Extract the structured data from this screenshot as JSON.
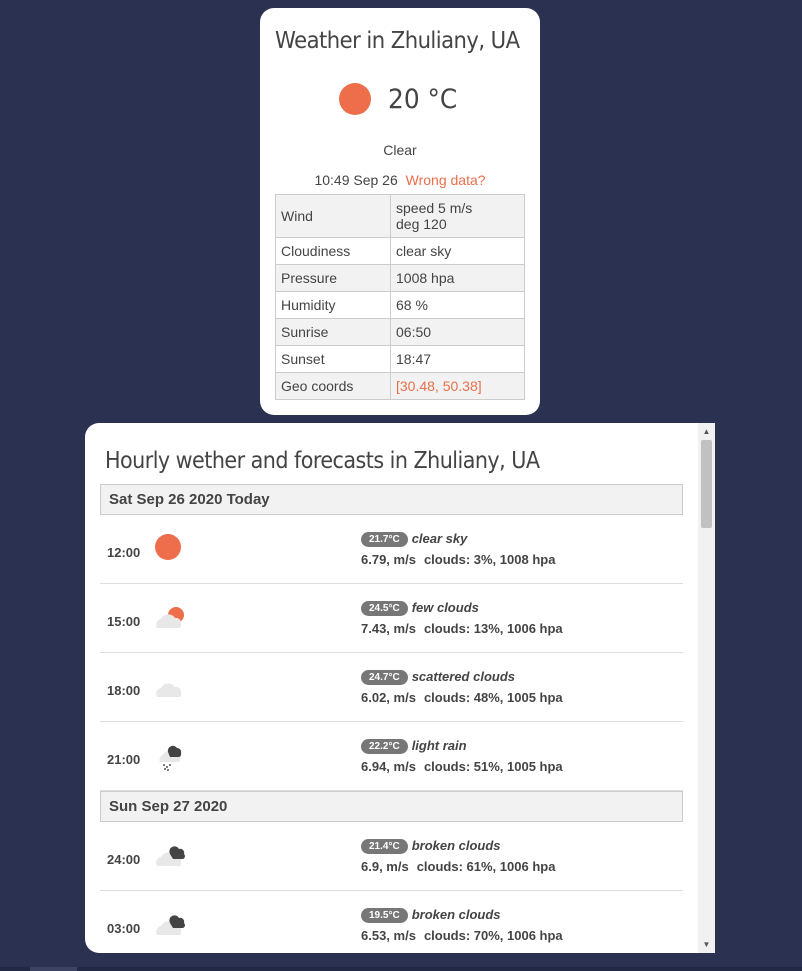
{
  "current": {
    "title": "Weather in Zhuliany, UA",
    "temperature": "20 °C",
    "icon": "sun-icon",
    "description": "Clear",
    "time": "10:49 Sep 26",
    "wrong_data_link": "Wrong data?",
    "details": [
      {
        "label": "Wind",
        "value": "speed 5 m/s",
        "value2": "deg 120"
      },
      {
        "label": "Cloudiness",
        "value": "clear sky"
      },
      {
        "label": "Pressure",
        "value": "1008 hpa"
      },
      {
        "label": "Humidity",
        "value": "68 %"
      },
      {
        "label": "Sunrise",
        "value": "06:50"
      },
      {
        "label": "Sunset",
        "value": "18:47"
      },
      {
        "label": "Geo coords",
        "value": "[30.48, 50.38]"
      }
    ]
  },
  "hourly": {
    "title": "Hourly wether and forecasts in Zhuliany, UA",
    "days": [
      {
        "label": "Sat Sep 26 2020 Today",
        "rows": [
          {
            "time": "12:00",
            "icon": "sun-icon",
            "temp": "21.7°C",
            "condition": "clear sky",
            "wind": "6.79, m/s",
            "clouds": "clouds: 3%, 1008 hpa"
          },
          {
            "time": "15:00",
            "icon": "few-clouds-icon",
            "temp": "24.5°C",
            "condition": "few clouds",
            "wind": "7.43, m/s",
            "clouds": "clouds: 13%, 1006 hpa"
          },
          {
            "time": "18:00",
            "icon": "cloud-icon",
            "temp": "24.7°C",
            "condition": "scattered clouds",
            "wind": "6.02, m/s",
            "clouds": "clouds: 48%, 1005 hpa"
          },
          {
            "time": "21:00",
            "icon": "light-rain-icon",
            "temp": "22.2°C",
            "condition": "light rain",
            "wind": "6.94, m/s",
            "clouds": "clouds: 51%, 1005 hpa"
          }
        ]
      },
      {
        "label": "Sun Sep 27 2020",
        "rows": [
          {
            "time": "24:00",
            "icon": "broken-clouds-icon",
            "temp": "21.4°C",
            "condition": "broken clouds",
            "wind": "6.9, m/s",
            "clouds": "clouds: 61%, 1006 hpa"
          },
          {
            "time": "03:00",
            "icon": "broken-clouds-icon",
            "temp": "19.5°C",
            "condition": "broken clouds",
            "wind": "6.53, m/s",
            "clouds": "clouds: 70%, 1006 hpa"
          }
        ]
      }
    ]
  },
  "colors": {
    "background": "#2a3151",
    "accent": "#ee6e4c",
    "badge": "#777777"
  }
}
